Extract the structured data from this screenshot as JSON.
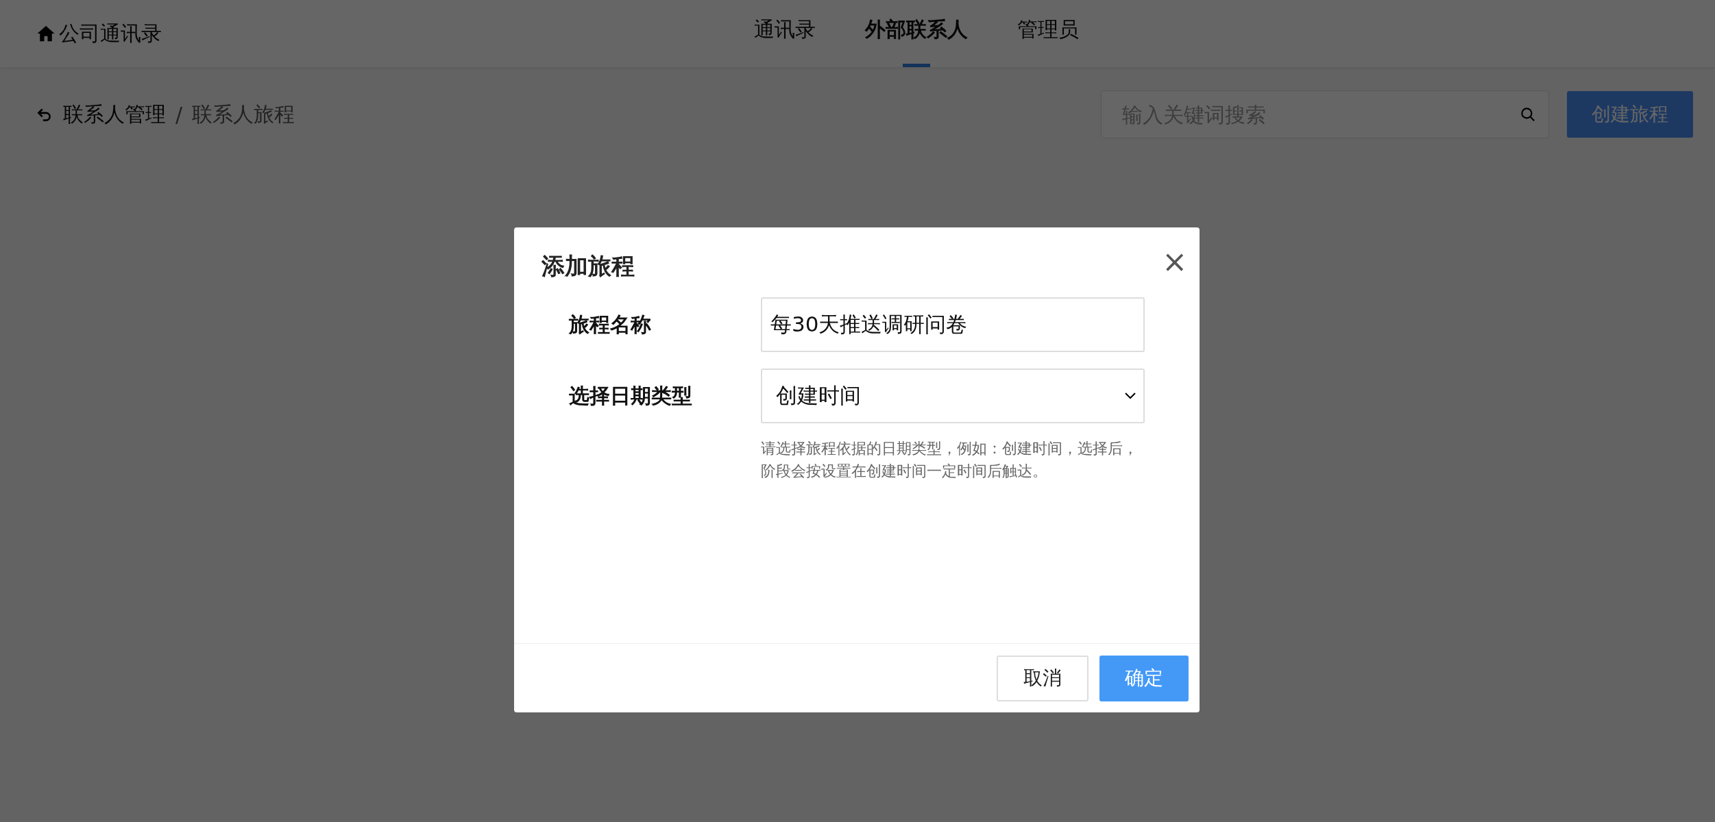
{
  "header": {
    "title": "公司通讯录",
    "tabs": [
      {
        "label": "通讯录",
        "selected": false
      },
      {
        "label": "外部联系人",
        "selected": true
      },
      {
        "label": "管理员",
        "selected": false
      }
    ]
  },
  "breadcrumb": {
    "parent": "联系人管理",
    "separator": "/",
    "current": "联系人旅程"
  },
  "search": {
    "placeholder": "输入关键词搜索"
  },
  "create_button": "创建旅程",
  "dialog": {
    "title": "添加旅程",
    "close": "×",
    "fields": [
      {
        "kind": "text",
        "label": "旅程名称",
        "value": "每30天推送调研问卷"
      },
      {
        "kind": "select",
        "label": "选择日期类型",
        "value": "创建时间",
        "hint": "请选择旅程依据的日期类型，例如：创建时间，选择后，阶段会按设置在创建时间一定时间后触达。"
      }
    ],
    "buttons": [
      {
        "label": "取消",
        "kind": "secondary"
      },
      {
        "label": "确定",
        "kind": "primary"
      }
    ]
  }
}
